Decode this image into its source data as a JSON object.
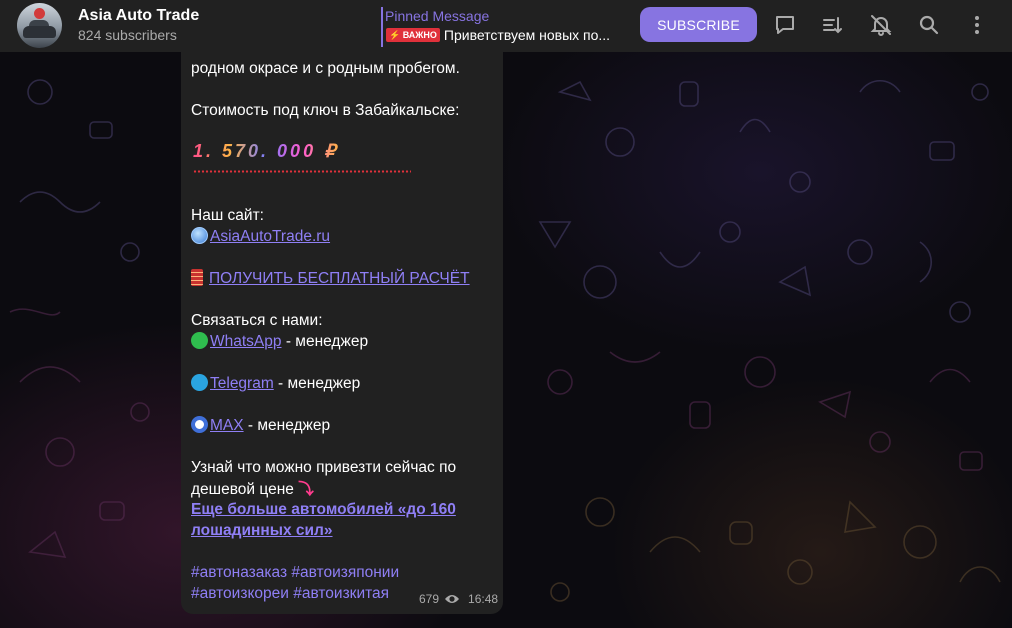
{
  "header": {
    "channel_title": "Asia Auto Trade",
    "subscribers": "824 subscribers",
    "pinned_label": "Pinned Message",
    "pinned_badge": "⚡ ВАЖНО",
    "pinned_text": "Приветствуем новых по...",
    "subscribe_label": "SUBSCRIBE",
    "icons": [
      "comments-icon",
      "sort-icon",
      "mute-icon",
      "search-icon",
      "more-vertical-icon"
    ]
  },
  "message": {
    "line_cut": "родном окрасе и с родным пробегом.",
    "price_intro": "Стоимость под ключ  в Забайкальске:",
    "price": "1. 570. 000 ₽",
    "site_label": "Наш сайт:",
    "site_link": "AsiaAutoTrade.ru",
    "calc_link": "ПОЛУЧИТЬ БЕСПЛАТНЫЙ РАСЧЁТ",
    "contact_label": "Связаться с нами:",
    "contacts": [
      {
        "name": "WhatsApp",
        "role": " - менеджер"
      },
      {
        "name": "Telegram",
        "role": " - менеджер"
      },
      {
        "name": "MAX",
        "role": " - менеджер"
      }
    ],
    "promo_line1": "Узнай что можно привезти сейчас по",
    "promo_line2": "дешевой цене",
    "promo_link_1": "Еще больше автомобилей «до 160",
    "promo_link_2": "лошадинных сил»",
    "tags_1": "#автоназаказ #автоизяпонии",
    "tags_2": "#автоизкореи #автоизкитая",
    "views": "679",
    "time": "16:48"
  },
  "colors": {
    "accent": "#8774e1",
    "header_bg": "#212121",
    "bubble_bg": "#212121",
    "badge_red": "#e0313b"
  }
}
